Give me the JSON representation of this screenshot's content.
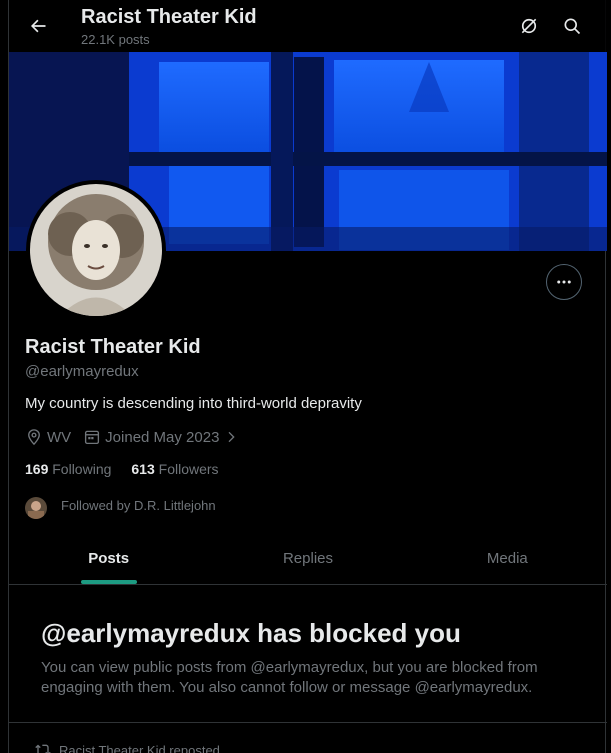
{
  "header": {
    "title": "Racist Theater Kid",
    "post_count": "22.1K posts"
  },
  "profile": {
    "name": "Racist Theater Kid",
    "handle": "@earlymayredux",
    "bio": "My country is descending into third-world depravity",
    "location": "WV",
    "joined": "Joined May 2023",
    "following_count": "169",
    "following_label": "Following",
    "followers_count": "613",
    "followers_label": "Followers",
    "followed_by": "Followed by D.R. Littlejohn"
  },
  "tabs": [
    {
      "label": "Posts",
      "active": true
    },
    {
      "label": "Replies",
      "active": false
    },
    {
      "label": "Media",
      "active": false
    }
  ],
  "blocked": {
    "title": "@earlymayredux has blocked you",
    "message": "You can view public posts from @earlymayredux, but you are blocked from engaging with them. You also cannot follow or message @earlymayredux."
  },
  "repost": {
    "text": "Racist Theater Kid reposted"
  },
  "icons": [
    "back-arrow-icon",
    "grok-icon",
    "search-icon",
    "more-icon",
    "location-icon",
    "calendar-icon",
    "chevron-right-icon",
    "repost-icon"
  ],
  "colors": {
    "background": "#000000",
    "text": "#e7e9ea",
    "secondary_text": "#71767b",
    "border": "#2f3336",
    "tab_indicator": "#1d9b82"
  }
}
